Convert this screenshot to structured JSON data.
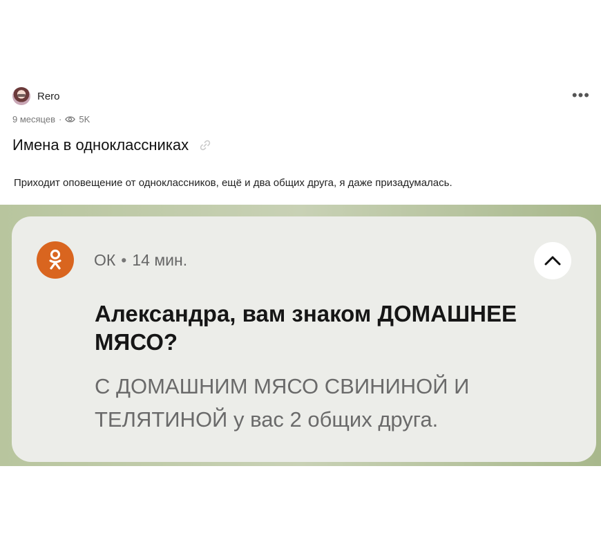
{
  "post": {
    "author": "Rero",
    "age": "9 месяцев",
    "views": "5K",
    "more_label": "•••",
    "title": "Имена в одноклассниках",
    "text": "Приходит оповещение от одноклассников, ещё и два общих друга, я даже призадумалась."
  },
  "notification": {
    "app_name": "ОК",
    "separator": "•",
    "time": "14 мин.",
    "title": "Александра, вам знаком ДОМАШНЕЕ МЯСО?",
    "body": "С ДОМАШНИМ МЯСО СВИНИНОЙ И ТЕЛЯТИНОЙ у вас 2 общих друга."
  },
  "colors": {
    "ok_brand": "#d9651f",
    "card_bg": "#ecede9",
    "screenshot_bg": "#b8c59e"
  },
  "icons": [
    "eye-icon",
    "link-icon",
    "ok-logo-icon",
    "chevron-up-icon",
    "more-icon"
  ]
}
